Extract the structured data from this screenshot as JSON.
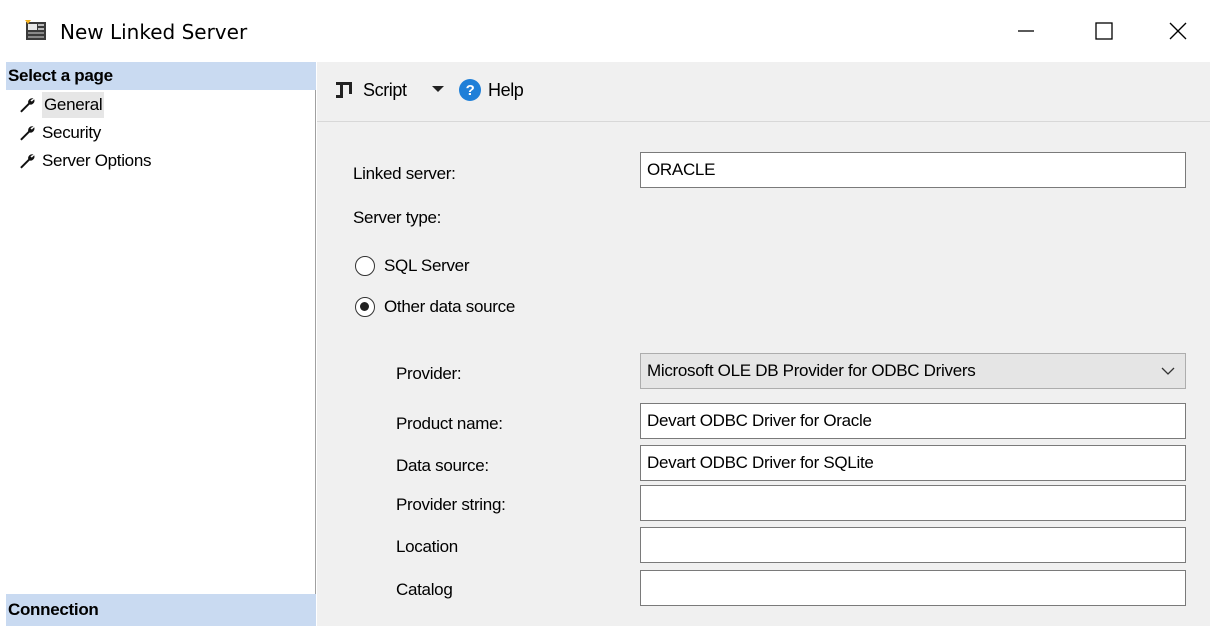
{
  "window": {
    "title": "New Linked Server",
    "controls": {
      "minimize": "minimize",
      "maximize": "maximize",
      "close": "close"
    }
  },
  "nav": {
    "header": "Select a page",
    "items": [
      {
        "label": "General",
        "icon": "wrench-icon",
        "selected": true
      },
      {
        "label": "Security",
        "icon": "wrench-icon",
        "selected": false
      },
      {
        "label": "Server Options",
        "icon": "wrench-icon",
        "selected": false
      }
    ],
    "footer_header": "Connection"
  },
  "toolbar": {
    "script_label": "Script",
    "help_label": "Help",
    "help_glyph": "?"
  },
  "form": {
    "linked_server_label": "Linked server:",
    "linked_server_value": "ORACLE",
    "server_type_label": "Server type:",
    "radio_sql_server": "SQL Server",
    "radio_other": "Other data source",
    "selected_server_type": "Other data source",
    "provider_label": "Provider:",
    "provider_value": "Microsoft OLE DB Provider for ODBC Drivers",
    "product_name_label": "Product name:",
    "product_name_value": "Devart ODBC Driver for Oracle",
    "data_source_label": "Data source:",
    "data_source_value": "Devart ODBC Driver for SQLite",
    "provider_string_label": "Provider string:",
    "provider_string_value": "",
    "location_label": "Location",
    "location_value": "",
    "catalog_label": "Catalog",
    "catalog_value": ""
  },
  "colors": {
    "pane_header_bg": "#c9daf1",
    "content_bg": "#f0f0f0",
    "help_icon": "#1e7fd8"
  }
}
